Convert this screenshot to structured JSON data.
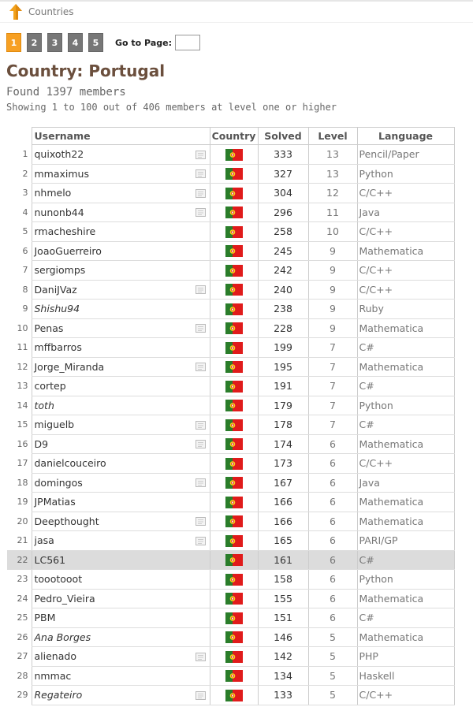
{
  "nav": {
    "back_label": "Countries"
  },
  "pager": {
    "pages": [
      "1",
      "2",
      "3",
      "4",
      "5"
    ],
    "active": "1",
    "goto_label": "Go to Page:"
  },
  "heading": {
    "title": "Country: Portugal",
    "found": "Found 1397 members",
    "showing": "Showing 1 to 100 out of 406 members at level one or higher"
  },
  "table": {
    "headers": {
      "username": "Username",
      "country": "Country",
      "solved": "Solved",
      "level": "Level",
      "language": "Language"
    },
    "rows": [
      {
        "n": "1",
        "user": "quixoth22",
        "note": true,
        "italic": false,
        "solved": "333",
        "level": "13",
        "lang": "Pencil/Paper"
      },
      {
        "n": "2",
        "user": "mmaximus",
        "note": true,
        "italic": false,
        "solved": "327",
        "level": "13",
        "lang": "Python"
      },
      {
        "n": "3",
        "user": "nhmelo",
        "note": true,
        "italic": false,
        "solved": "304",
        "level": "12",
        "lang": "C/C++"
      },
      {
        "n": "4",
        "user": "nunonb44",
        "note": true,
        "italic": false,
        "solved": "296",
        "level": "11",
        "lang": "Java"
      },
      {
        "n": "5",
        "user": "rmacheshire",
        "note": false,
        "italic": false,
        "solved": "258",
        "level": "10",
        "lang": "C/C++"
      },
      {
        "n": "6",
        "user": "JoaoGuerreiro",
        "note": false,
        "italic": false,
        "solved": "245",
        "level": "9",
        "lang": "Mathematica"
      },
      {
        "n": "7",
        "user": "sergiomps",
        "note": false,
        "italic": false,
        "solved": "242",
        "level": "9",
        "lang": "C/C++"
      },
      {
        "n": "8",
        "user": "DaniJVaz",
        "note": true,
        "italic": false,
        "solved": "240",
        "level": "9",
        "lang": "C/C++"
      },
      {
        "n": "9",
        "user": "Shishu94",
        "note": false,
        "italic": true,
        "solved": "238",
        "level": "9",
        "lang": "Ruby"
      },
      {
        "n": "10",
        "user": "Penas",
        "note": true,
        "italic": false,
        "solved": "228",
        "level": "9",
        "lang": "Mathematica"
      },
      {
        "n": "11",
        "user": "mffbarros",
        "note": false,
        "italic": false,
        "solved": "199",
        "level": "7",
        "lang": "C#"
      },
      {
        "n": "12",
        "user": "Jorge_Miranda",
        "note": true,
        "italic": false,
        "solved": "195",
        "level": "7",
        "lang": "Mathematica"
      },
      {
        "n": "13",
        "user": "cortep",
        "note": false,
        "italic": false,
        "solved": "191",
        "level": "7",
        "lang": "C#"
      },
      {
        "n": "14",
        "user": "toth",
        "note": false,
        "italic": true,
        "solved": "179",
        "level": "7",
        "lang": "Python"
      },
      {
        "n": "15",
        "user": "miguelb",
        "note": true,
        "italic": false,
        "solved": "178",
        "level": "7",
        "lang": "C#"
      },
      {
        "n": "16",
        "user": "D9",
        "note": true,
        "italic": false,
        "solved": "174",
        "level": "6",
        "lang": "Mathematica"
      },
      {
        "n": "17",
        "user": "danielcouceiro",
        "note": false,
        "italic": false,
        "solved": "173",
        "level": "6",
        "lang": "C/C++"
      },
      {
        "n": "18",
        "user": "domingos",
        "note": true,
        "italic": false,
        "solved": "167",
        "level": "6",
        "lang": "Java"
      },
      {
        "n": "19",
        "user": "JPMatias",
        "note": false,
        "italic": false,
        "solved": "166",
        "level": "6",
        "lang": "Mathematica"
      },
      {
        "n": "20",
        "user": "Deepthought",
        "note": true,
        "italic": false,
        "solved": "166",
        "level": "6",
        "lang": "Mathematica"
      },
      {
        "n": "21",
        "user": "jasa",
        "note": true,
        "italic": false,
        "solved": "165",
        "level": "6",
        "lang": "PARI/GP"
      },
      {
        "n": "22",
        "user": "LC561",
        "note": false,
        "italic": false,
        "solved": "161",
        "level": "6",
        "lang": "C#",
        "highlight": true
      },
      {
        "n": "23",
        "user": "toootooot",
        "note": false,
        "italic": false,
        "solved": "158",
        "level": "6",
        "lang": "Python"
      },
      {
        "n": "24",
        "user": "Pedro_Vieira",
        "note": false,
        "italic": false,
        "solved": "155",
        "level": "6",
        "lang": "Mathematica"
      },
      {
        "n": "25",
        "user": "PBM",
        "note": false,
        "italic": false,
        "solved": "151",
        "level": "6",
        "lang": "C#"
      },
      {
        "n": "26",
        "user": "Ana Borges",
        "note": false,
        "italic": true,
        "solved": "146",
        "level": "5",
        "lang": "Mathematica"
      },
      {
        "n": "27",
        "user": "alienado",
        "note": true,
        "italic": false,
        "solved": "142",
        "level": "5",
        "lang": "PHP"
      },
      {
        "n": "28",
        "user": "nmmac",
        "note": false,
        "italic": false,
        "solved": "134",
        "level": "5",
        "lang": "Haskell"
      },
      {
        "n": "29",
        "user": "Regateiro",
        "note": true,
        "italic": true,
        "solved": "133",
        "level": "5",
        "lang": "C/C++"
      }
    ]
  },
  "colors": {
    "accent_page": "#f7a023",
    "title": "#6b4f3d",
    "highlight_row": "#dcdcdc"
  }
}
